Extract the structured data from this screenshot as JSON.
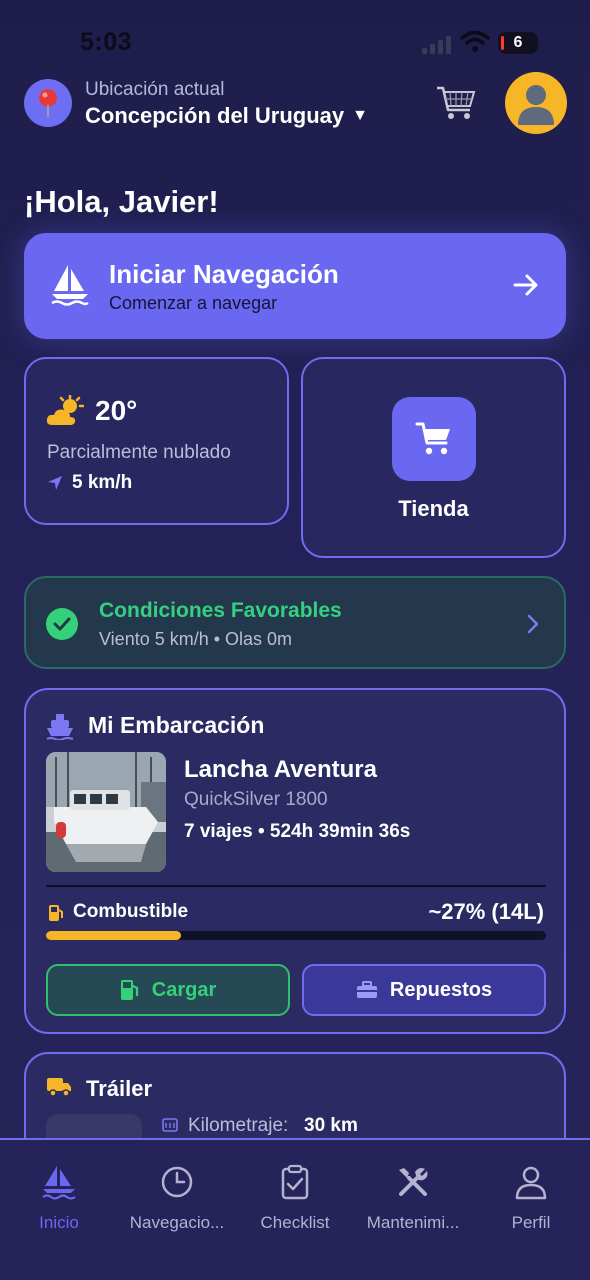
{
  "status_bar": {
    "time": "5:03",
    "battery": "6"
  },
  "header": {
    "location_label": "Ubicación actual",
    "location_value": "Concepción del Uruguay",
    "location_caret": "▼",
    "cart_icon": "cart-icon",
    "avatar_icon": "person-icon"
  },
  "greeting": "¡Hola, Javier!",
  "start_navigation": {
    "title": "Iniciar Navegación",
    "subtitle": "Comenzar a navegar",
    "icon": "sailboat-icon"
  },
  "weather": {
    "temperature": "20°",
    "description": "Parcialmente nublado",
    "wind": "5 km/h",
    "icon": "partly-cloudy-icon"
  },
  "store": {
    "label": "Tienda",
    "icon": "cart-icon"
  },
  "conditions": {
    "title": "Condiciones Favorables",
    "detail": "Viento 5 km/h • Olas 0m",
    "color": "#35d07f"
  },
  "boat": {
    "section_title": "Mi Embarcación",
    "name": "Lancha Aventura",
    "model": "QuickSilver 1800",
    "stats": "7 viajes • 524h 39min 36s",
    "fuel_label": "Combustible",
    "fuel_value": "~27% (14L)",
    "fuel_fraction": 0.27,
    "load_button": "Cargar",
    "parts_button": "Repuestos"
  },
  "trailer": {
    "section_title": "Tráiler",
    "mileage_label": "Kilometraje:",
    "mileage_value": "30 km"
  },
  "tabbar": {
    "items": [
      {
        "label": "Inicio",
        "icon": "sailboat-icon",
        "active": true
      },
      {
        "label": "Navegacio...",
        "icon": "clock-icon",
        "active": false
      },
      {
        "label": "Checklist",
        "icon": "clipboard-check-icon",
        "active": false
      },
      {
        "label": "Mantenimi...",
        "icon": "tools-icon",
        "active": false
      },
      {
        "label": "Perfil",
        "icon": "person-icon",
        "active": false
      }
    ]
  },
  "colors": {
    "accent": "#6a67f0",
    "success": "#35d07f",
    "fuel": "#f7b528",
    "background": "#232157"
  }
}
